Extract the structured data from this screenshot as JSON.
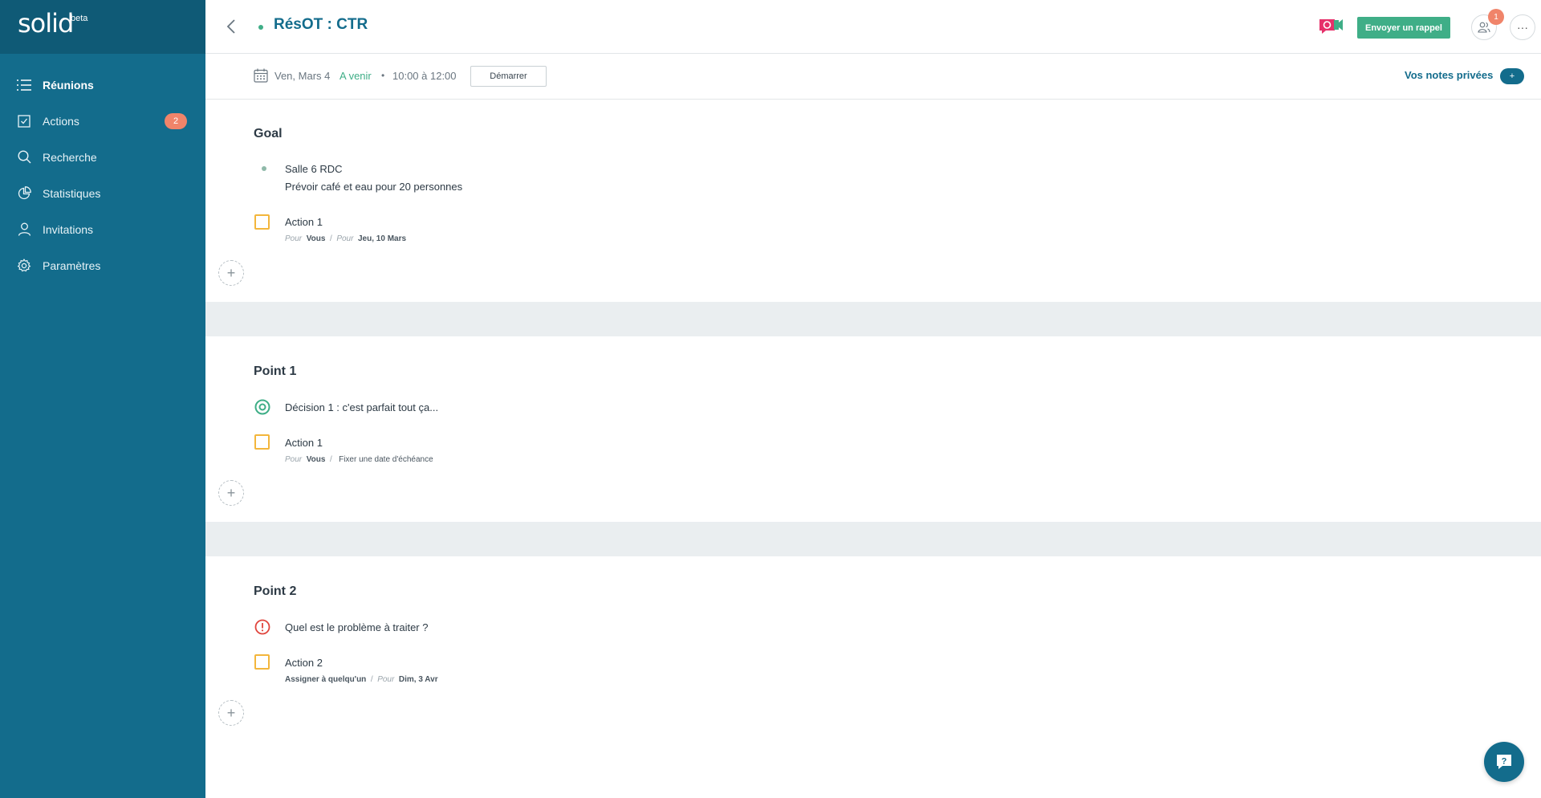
{
  "app": {
    "logo": "solid",
    "beta": "beta"
  },
  "sidebar": {
    "items": [
      {
        "label": "Réunions",
        "icon": "list-icon",
        "active": true
      },
      {
        "label": "Actions",
        "icon": "checkbox-icon",
        "badge": "2"
      },
      {
        "label": "Recherche",
        "icon": "search-icon"
      },
      {
        "label": "Statistiques",
        "icon": "pie-chart-icon"
      },
      {
        "label": "Invitations",
        "icon": "user-icon"
      },
      {
        "label": "Paramètres",
        "icon": "gear-icon"
      }
    ]
  },
  "header": {
    "title": "RésOT : CTR",
    "reminder_label": "Envoyer un rappel",
    "participants_badge": "1",
    "more_label": "···"
  },
  "subheader": {
    "date": "Ven, Mars 4",
    "status": "A venir",
    "separator": "•",
    "time": "10:00 à 12:00",
    "start_label": "Démarrer",
    "private_notes": "Vos notes privées",
    "private_plus": "+"
  },
  "sections": [
    {
      "title": "Goal",
      "note_lines": [
        "Salle 6 RDC",
        "Prévoir café et eau pour 20 personnes"
      ],
      "action": {
        "label": "Action 1",
        "for_label": "Pour",
        "assignee": "Vous",
        "sep": "/",
        "due_label": "Pour",
        "due": "Jeu, 10 Mars"
      }
    },
    {
      "title": "Point 1",
      "decision": "Décision  1 : c'est parfait tout ça...",
      "action": {
        "label": "Action 1",
        "for_label": "Pour",
        "assignee": "Vous",
        "sep": "/",
        "due": "Fixer une date d'échéance"
      }
    },
    {
      "title": "Point 2",
      "problem": "Quel est le problème à traiter ?",
      "action": {
        "label": "Action 2",
        "assignee": "Assigner à quelqu'un",
        "sep": "/",
        "due_label": "Pour",
        "due": "Dim, 3 Avr"
      }
    }
  ],
  "add_label": "+",
  "help_label": "?",
  "colors": {
    "sidebar": "#136c8c",
    "accent_green": "#3fae87",
    "badge": "#f0846a",
    "checkbox": "#f3b63c",
    "problem": "#e0443c"
  }
}
